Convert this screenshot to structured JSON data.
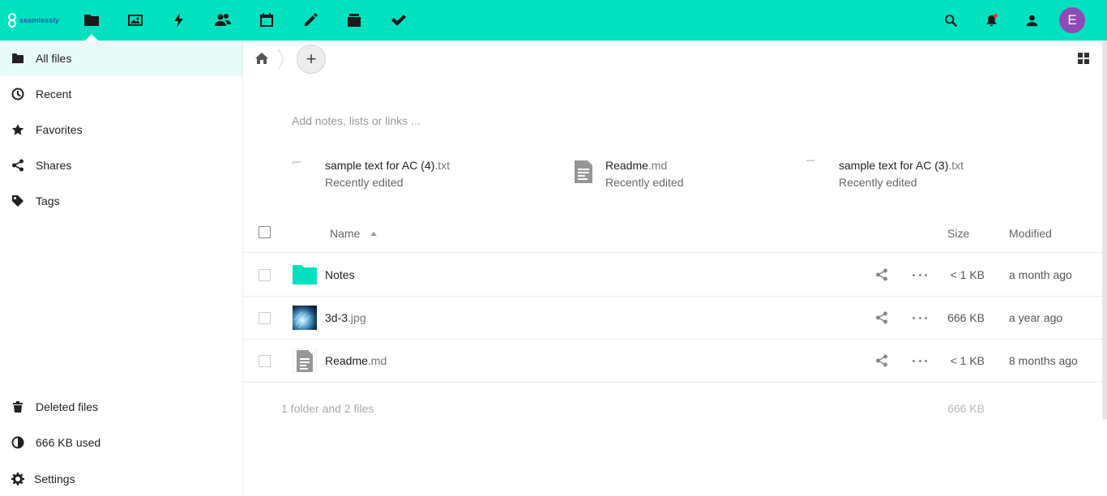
{
  "header": {
    "logo_text": "seamlessly",
    "brand_color": "#00e1c0",
    "apps": [
      {
        "name": "files",
        "icon": "folder-icon",
        "active": true
      },
      {
        "name": "photos",
        "icon": "image-icon"
      },
      {
        "name": "activity",
        "icon": "lightning-icon"
      },
      {
        "name": "contacts",
        "icon": "contacts-icon"
      },
      {
        "name": "calendar",
        "icon": "calendar-icon"
      },
      {
        "name": "notes",
        "icon": "pencil-icon"
      },
      {
        "name": "deck",
        "icon": "deck-icon"
      },
      {
        "name": "tasks",
        "icon": "checkmark-icon"
      }
    ],
    "right": {
      "search_icon": "search-icon",
      "notifications_icon": "bell-icon",
      "contacts_icon": "contacts-menu-icon"
    },
    "avatar_initial": "E",
    "avatar_color": "#8e4bb6"
  },
  "sidebar": {
    "items": [
      {
        "label": "All files",
        "icon": "folder-icon",
        "active": true
      },
      {
        "label": "Recent",
        "icon": "clock-icon"
      },
      {
        "label": "Favorites",
        "icon": "star-icon"
      },
      {
        "label": "Shares",
        "icon": "share-icon"
      },
      {
        "label": "Tags",
        "icon": "tag-icon"
      }
    ],
    "bottom": [
      {
        "label": "Deleted files",
        "icon": "trash-icon"
      },
      {
        "label": "666 KB used",
        "icon": "quota-pie-icon"
      },
      {
        "label": "Settings",
        "icon": "gear-icon"
      }
    ]
  },
  "breadcrumb": {
    "home_icon": "home-icon",
    "add_icon": "plus-icon",
    "add_label": "+"
  },
  "notes_placeholder": "Add notes, lists or links ...",
  "recent_files": [
    {
      "base": "sample text for AC (4)",
      "ext": ".txt",
      "sub": "Recently edited"
    },
    {
      "base": "Readme",
      "ext": ".md",
      "sub": "Recently edited"
    },
    {
      "base": "sample text for AC (3)",
      "ext": ".txt",
      "sub": "Recently edited"
    }
  ],
  "table": {
    "headers": {
      "name": "Name",
      "size": "Size",
      "modified": "Modified"
    },
    "rows": [
      {
        "base": "Notes",
        "ext": "",
        "type": "folder",
        "size": "< 1 KB",
        "modified": "a month ago"
      },
      {
        "base": "3d-3",
        "ext": ".jpg",
        "type": "image",
        "size": "666 KB",
        "modified": "a year ago"
      },
      {
        "base": "Readme",
        "ext": ".md",
        "type": "text",
        "size": "< 1 KB",
        "modified": "8 months ago"
      }
    ],
    "summary": "1 folder and 2 files",
    "summary_size": "666 KB"
  }
}
